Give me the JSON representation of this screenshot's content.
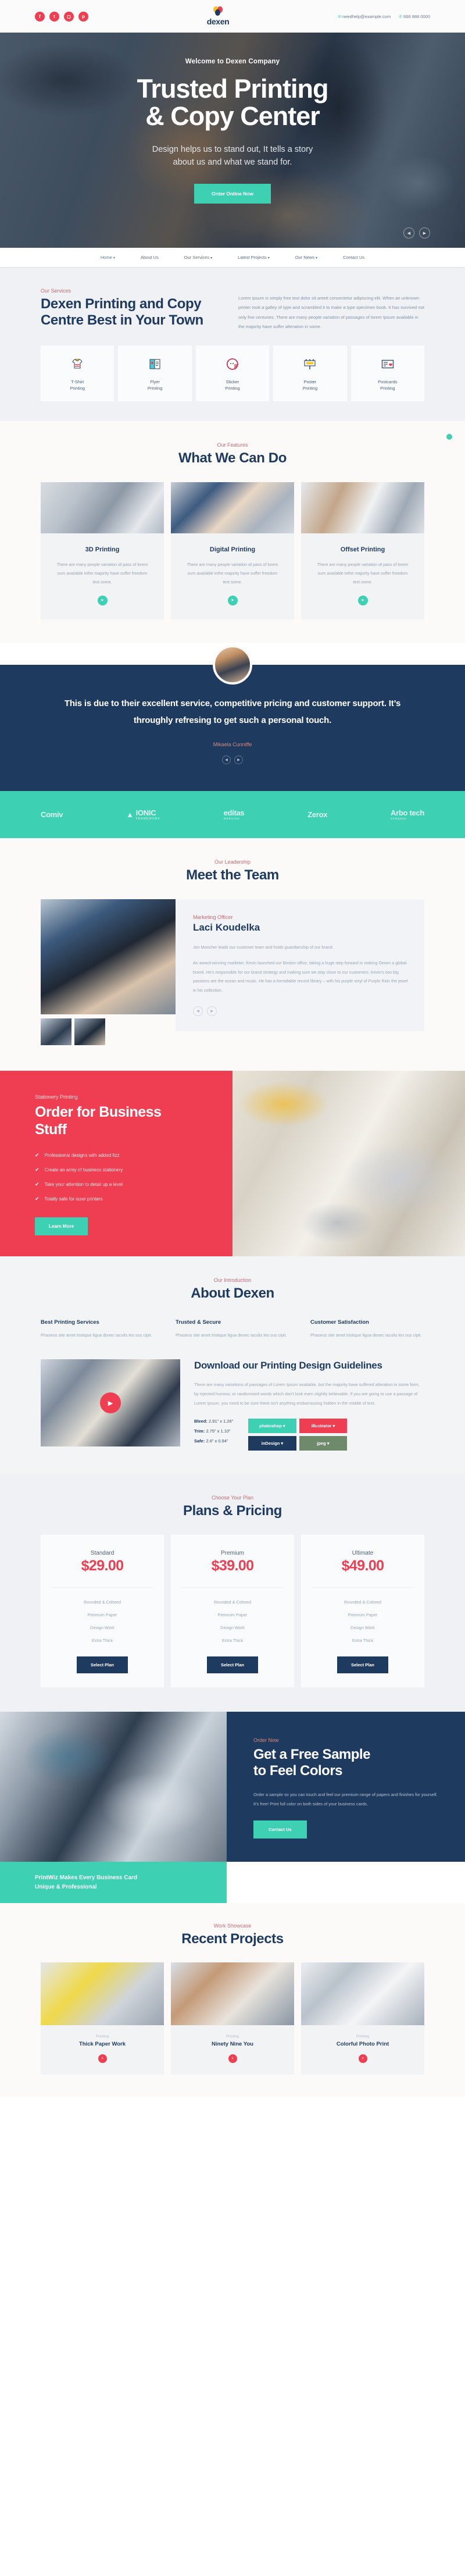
{
  "topbar": {
    "social": [
      {
        "name": "facebook-icon",
        "glyph": "f"
      },
      {
        "name": "twitter-icon",
        "glyph": "t"
      },
      {
        "name": "instagram-icon",
        "glyph": "◻"
      },
      {
        "name": "pinterest-icon",
        "glyph": "p"
      }
    ],
    "brand_name": "dexen",
    "email": "needhelp@example.com",
    "phone": "666 888 0000",
    "email_icon": "envelope-icon",
    "phone_icon": "phone-icon"
  },
  "hero": {
    "eyebrow": "Welcome to Dexen Company",
    "title_line1": "Trusted Printing",
    "title_line2": "& Copy Center",
    "subtitle_line1": "Design helps us to stand out, It tells a story",
    "subtitle_line2": "about us and what we stand for.",
    "cta": "Order Online Now",
    "prev_icon": "chevron-left-icon",
    "next_icon": "chevron-right-icon"
  },
  "nav": {
    "items": [
      {
        "label": "Home",
        "caret": true,
        "active": true
      },
      {
        "label": "About Us",
        "caret": false,
        "active": false
      },
      {
        "label": "Our Services",
        "caret": true,
        "active": false
      },
      {
        "label": "Latest Projects",
        "caret": true,
        "active": false
      },
      {
        "label": "Our News",
        "caret": true,
        "active": false
      },
      {
        "label": "Contact Us",
        "caret": false,
        "active": false
      }
    ]
  },
  "services": {
    "eyebrow": "Our Services",
    "heading": "Dexen Printing and Copy Centre Best in Your Town",
    "paragraph": "Lorem Ipsum is simply free text dolor sit amett consectetur adipiscing elit. When an unknown printer took a galley of type and scrambled it to make a type specimen book. It has survived not only five centuries. There are many people variation of passages of lorem Ipsum available in the majority have suffer alteration in some.",
    "cards": [
      {
        "icon": "tshirt-icon",
        "line1": "T-Shirt",
        "line2": "Printing"
      },
      {
        "icon": "flyer-icon",
        "line1": "Flyer",
        "line2": "Printing"
      },
      {
        "icon": "sticker-icon",
        "line1": "Sticker",
        "line2": "Printing"
      },
      {
        "icon": "poster-icon",
        "line1": "Poster",
        "line2": "Printing"
      },
      {
        "icon": "postcard-icon",
        "line1": "Postcards",
        "line2": "Printing"
      }
    ]
  },
  "features": {
    "eyebrow": "Our Features",
    "heading": "What We Can Do",
    "cards": [
      {
        "title": "3D Printing",
        "text": "There are many people variation of pass of lorem sum available inthe majority have suffer freedom text some.",
        "arrow": "arrow-right-icon"
      },
      {
        "title": "Digital Printing",
        "text": "There are many people variation of pass of lorem sum available inthe majority have suffer freedom text some.",
        "arrow": "arrow-right-icon"
      },
      {
        "title": "Offset Printing",
        "text": "There are many people variation of pass of lorem sum available inthe majority have suffer freedom text some.",
        "arrow": "arrow-right-icon"
      }
    ]
  },
  "testimonial": {
    "quote": "This is due to their excellent service, competitive pricing and customer support. It’s throughly refresing to get such a personal touch.",
    "author": "Mikaela Cunniffe",
    "avatar": "customer-avatar",
    "prev_icon": "chevron-left-icon",
    "next_icon": "chevron-right-icon"
  },
  "brands": [
    {
      "name": "Comiv",
      "tagline": ""
    },
    {
      "name": "IONIC",
      "tagline": "FRAMEWORK"
    },
    {
      "name": "editas",
      "tagline": "medicine"
    },
    {
      "name": "Zerox",
      "tagline": ""
    },
    {
      "name": "Arbo tech",
      "tagline": "company"
    }
  ],
  "team": {
    "eyebrow": "Our Leadership",
    "heading": "Meet the Team",
    "role": "Marketing Officer",
    "name": "Laci Koudelka",
    "bio1": "Jen Moncher leads our customer team and holds guardianship of our brand.",
    "bio2": "An award-winning marketer, Kevin launched our Boston office, taking a huge step forward in making Dexen a global brand. He’s responsible for our brand strategy and making sure we stay close to our customers. Kevin’s two big passions are the ocean and music. He has a formidable record library – with his purple vinyl of Purple Rain the jewel in his collection.",
    "prev_icon": "chevron-left-icon",
    "next_icon": "chevron-right-icon"
  },
  "order": {
    "eyebrow": "Stationery Printing",
    "heading_line1": "Order for Business",
    "heading_line2": "Stuff",
    "features": [
      "Professional designs with added fizz",
      "Create an army of business stationery",
      "Take your attention to detail up a level",
      "Totally safe for laser printers"
    ],
    "check_icon": "check-icon",
    "cta": "Learn More"
  },
  "about": {
    "eyebrow": "Our Introduction",
    "heading": "About Dexen",
    "columns": [
      {
        "title": "Best Printing Services",
        "text": "Phaseus site amet tristique ligua donec iaculis leo sus cipit."
      },
      {
        "title": "Trusted & Secure",
        "text": "Phaseus site amet tristique ligua donec iaculis leo sus cipit."
      },
      {
        "title": "Customer Satisfaction",
        "text": "Phaseus site amet tristique ligua donec iaculis leo sus cipit."
      }
    ],
    "download": {
      "play_icon": "play-icon",
      "heading": "Download our Printing Design Guidelines",
      "paragraph": "There are many variations of passages of Lorem Ipsum available, but the majority have suffered alteration in some form, by injected humour, or randomised words which don't look even slightly believable. If you are going to use a passage of Lorem Ipsum, you need to be sure there isn't anything embarrassing hidden in the middle of text.",
      "specs": [
        {
          "label": "Bleed:",
          "value": "2.91” x 1.26”"
        },
        {
          "label": "Trim:",
          "value": "2.75” x 1.10”"
        },
        {
          "label": "Safe:",
          "value": "2.6” x 0.94”"
        }
      ],
      "buttons": [
        {
          "label": "photoshop",
          "color": "#3ed0b2",
          "caret": "chevron-down-icon"
        },
        {
          "label": "illustrator",
          "color": "#ef3e52",
          "caret": "chevron-down-icon"
        },
        {
          "label": "inDesign",
          "color": "#1e3a5f",
          "caret": "chevron-down-icon"
        },
        {
          "label": "jpeg",
          "color": "#6f8a6b",
          "caret": "chevron-down-icon"
        }
      ]
    }
  },
  "pricing": {
    "eyebrow": "Choose Your Plan",
    "heading": "Plans & Pricing",
    "plans": [
      {
        "name": "Standard",
        "price": "$29.00",
        "features": [
          "Rounded & Colored",
          "Preimum Paper",
          "Design Work",
          "Extra Thick"
        ],
        "cta": "Select Plan"
      },
      {
        "name": "Premium",
        "price": "$39.00",
        "features": [
          "Rounded & Colored",
          "Preimum Paper",
          "Design Work",
          "Extra Thick"
        ],
        "cta": "Select Plan"
      },
      {
        "name": "Ultimate",
        "price": "$49.00",
        "features": [
          "Rounded & Colored",
          "Preimum Paper",
          "Design Work",
          "Extra Thick"
        ],
        "cta": "Select Plan"
      }
    ]
  },
  "sample": {
    "eyebrow": "Order Now",
    "heading_line1": "Get a Free Sample",
    "heading_line2": "to Feel Colors",
    "paragraph": "Order a sample so you can touch and feel our premium range of papers and finishes for yourself. It’s free! Print full color on both sides of your business cards.",
    "cta": "Contact Us",
    "strip_line1": "PrintWiz Makes Every Business Card",
    "strip_line2": "Unique & Professional"
  },
  "projects": {
    "eyebrow": "Work Showcase",
    "heading": "Recent Projects",
    "cards": [
      {
        "category": "Printing",
        "title": "Thick Paper Work",
        "dot": "plus-icon"
      },
      {
        "category": "Printing",
        "title": "Ninety Nine You",
        "dot": "plus-icon"
      },
      {
        "category": "Printing",
        "title": "Colorful Photo Print",
        "dot": "plus-icon"
      }
    ]
  }
}
